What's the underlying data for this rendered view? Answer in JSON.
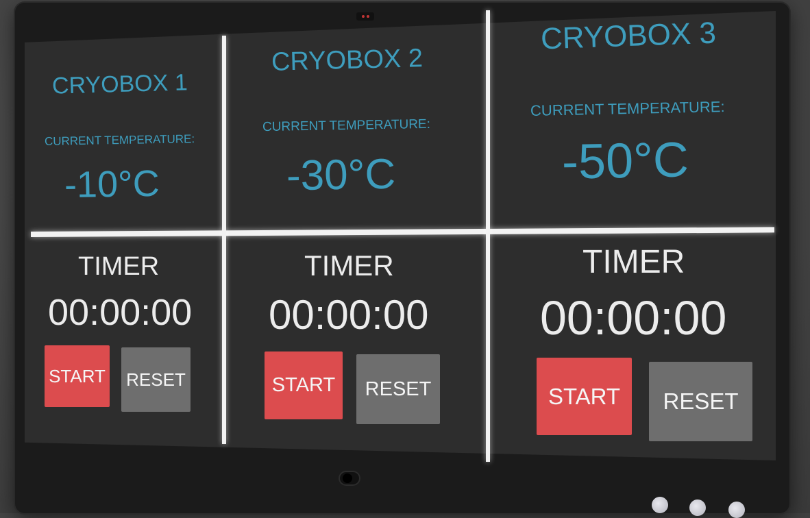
{
  "cryoboxes": [
    {
      "title": "CRYOBOX 1",
      "temperature_label": "CURRENT TEMPERATURE:",
      "temperature_value": "-10°C",
      "timer_label": "TIMER",
      "timer_value": "00:00:00",
      "start_label": "START",
      "reset_label": "RESET"
    },
    {
      "title": "CRYOBOX 2",
      "temperature_label": "CURRENT TEMPERATURE:",
      "temperature_value": "-30°C",
      "timer_label": "TIMER",
      "timer_value": "00:00:00",
      "start_label": "START",
      "reset_label": "RESET"
    },
    {
      "title": "CRYOBOX 3",
      "temperature_label": "CURRENT TEMPERATURE:",
      "temperature_value": "-50°C",
      "timer_label": "TIMER",
      "timer_value": "00:00:00",
      "start_label": "START",
      "reset_label": "RESET"
    }
  ],
  "colors": {
    "accent": "#3e9dbd",
    "start": "#dc4c4e",
    "reset": "#6e6e6e",
    "screen": "#2d2d2d",
    "divider": "#f2f2f2"
  },
  "icons": {
    "power": "power-button-icon",
    "camera": "webcam-icon",
    "leds": "indicator-light-icon"
  }
}
